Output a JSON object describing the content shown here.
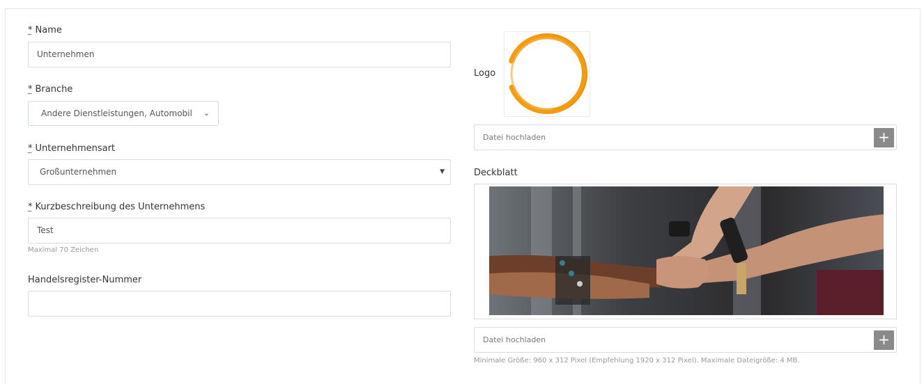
{
  "form": {
    "required_mark": "*",
    "name": {
      "label": "Name",
      "value": "Unternehmen"
    },
    "branche": {
      "label": "Branche",
      "value": "Andere Dienstleistungen, Automobil"
    },
    "unternehmensart": {
      "label": "Unternehmensart",
      "value": "Großunternehmen"
    },
    "kurzbeschreibung": {
      "label": "Kurzbeschreibung des Unternehmens",
      "value": "Test",
      "help": "Maximal 70 Zeichen"
    },
    "handelsregister": {
      "label": "Handelsregister-Nummer",
      "value": ""
    }
  },
  "logo": {
    "label": "Logo",
    "upload_placeholder": "Datei hochladen",
    "ring_color": "#f39c12"
  },
  "cover": {
    "label": "Deckblatt",
    "upload_placeholder": "Datei hochladen",
    "help": "Minimale Größe: 960 x 312 Pixel (Empfehlung 1920 x 312 Pixel). Maximale Dateigröße: 4 MB."
  },
  "icons": {
    "chevron": "⌄",
    "caret": "▼",
    "plus": "+"
  }
}
